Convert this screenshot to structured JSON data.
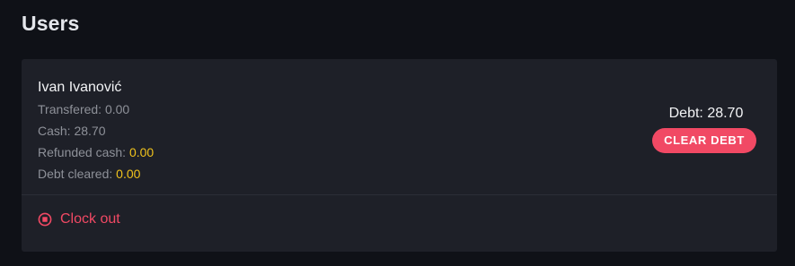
{
  "header": {
    "title": "Users"
  },
  "user_card": {
    "name": "Ivan Ivanović",
    "stats": {
      "transfered_label": "Transfered: ",
      "transfered_value": "0.00",
      "cash_label": "Cash: ",
      "cash_value": "28.70",
      "refunded_label": "Refunded cash: ",
      "refunded_value": "0.00",
      "debt_cleared_label": "Debt cleared: ",
      "debt_cleared_value": "0.00"
    },
    "debt_label": "Debt: 28.70",
    "clear_debt_label": "CLEAR DEBT",
    "clock_out_label": "Clock out"
  },
  "colors": {
    "background": "#0f1117",
    "card": "#1e2028",
    "accent": "#f14964",
    "highlight": "#f0c21c",
    "muted_text": "#8e9199"
  },
  "icons": {
    "clock_out": "stop-circle-icon"
  }
}
